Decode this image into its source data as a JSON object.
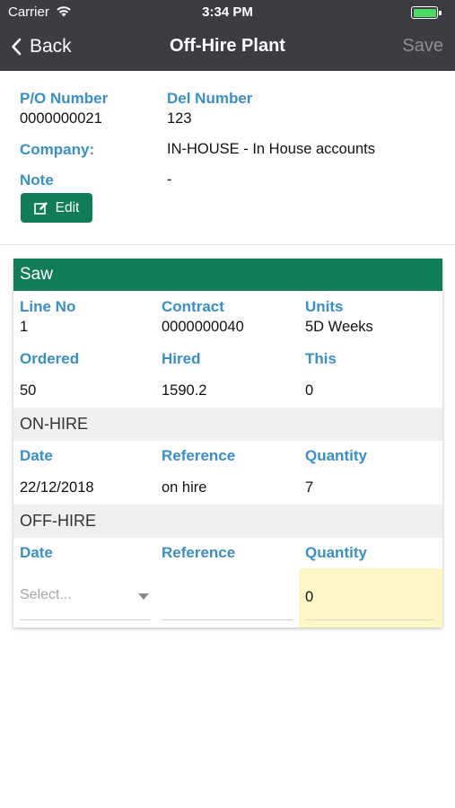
{
  "status_bar": {
    "carrier": "Carrier",
    "time": "3:34 PM"
  },
  "nav": {
    "back_label": "Back",
    "title": "Off-Hire Plant",
    "save_label": "Save"
  },
  "summary": {
    "po_number_label": "P/O Number",
    "po_number": "0000000021",
    "del_number_label": "Del Number",
    "del_number": "123",
    "company_label": "Company:",
    "company": "IN-HOUSE - In House accounts",
    "note_label": "Note",
    "note": "-",
    "edit_label": "Edit"
  },
  "item": {
    "name": "Saw",
    "line_no_label": "Line No",
    "line_no": "1",
    "contract_label": "Contract",
    "contract": "0000000040",
    "units_label": "Units",
    "units": "5D Weeks",
    "ordered_label": "Ordered",
    "ordered": "50",
    "hired_label": "Hired",
    "hired": "1590.2",
    "this_label": "This",
    "this": "0"
  },
  "on_hire": {
    "heading": "ON-HIRE",
    "date_label": "Date",
    "reference_label": "Reference",
    "quantity_label": "Quantity",
    "date": "22/12/2018",
    "reference": "on hire",
    "quantity": "7"
  },
  "off_hire": {
    "heading": "OFF-HIRE",
    "date_label": "Date",
    "reference_label": "Reference",
    "quantity_label": "Quantity",
    "date_placeholder": "Select...",
    "reference": "",
    "quantity": "0"
  },
  "colors": {
    "header_bg": "#3b3d42",
    "accent_green": "#117c5a",
    "label_blue": "#3a8fc7",
    "highlight_yellow": "#fff6c6"
  },
  "icons": {
    "back": "chevron-left-icon",
    "wifi": "wifi-icon",
    "battery": "battery-icon",
    "edit": "edit-icon",
    "dropdown": "caret-down-icon"
  }
}
